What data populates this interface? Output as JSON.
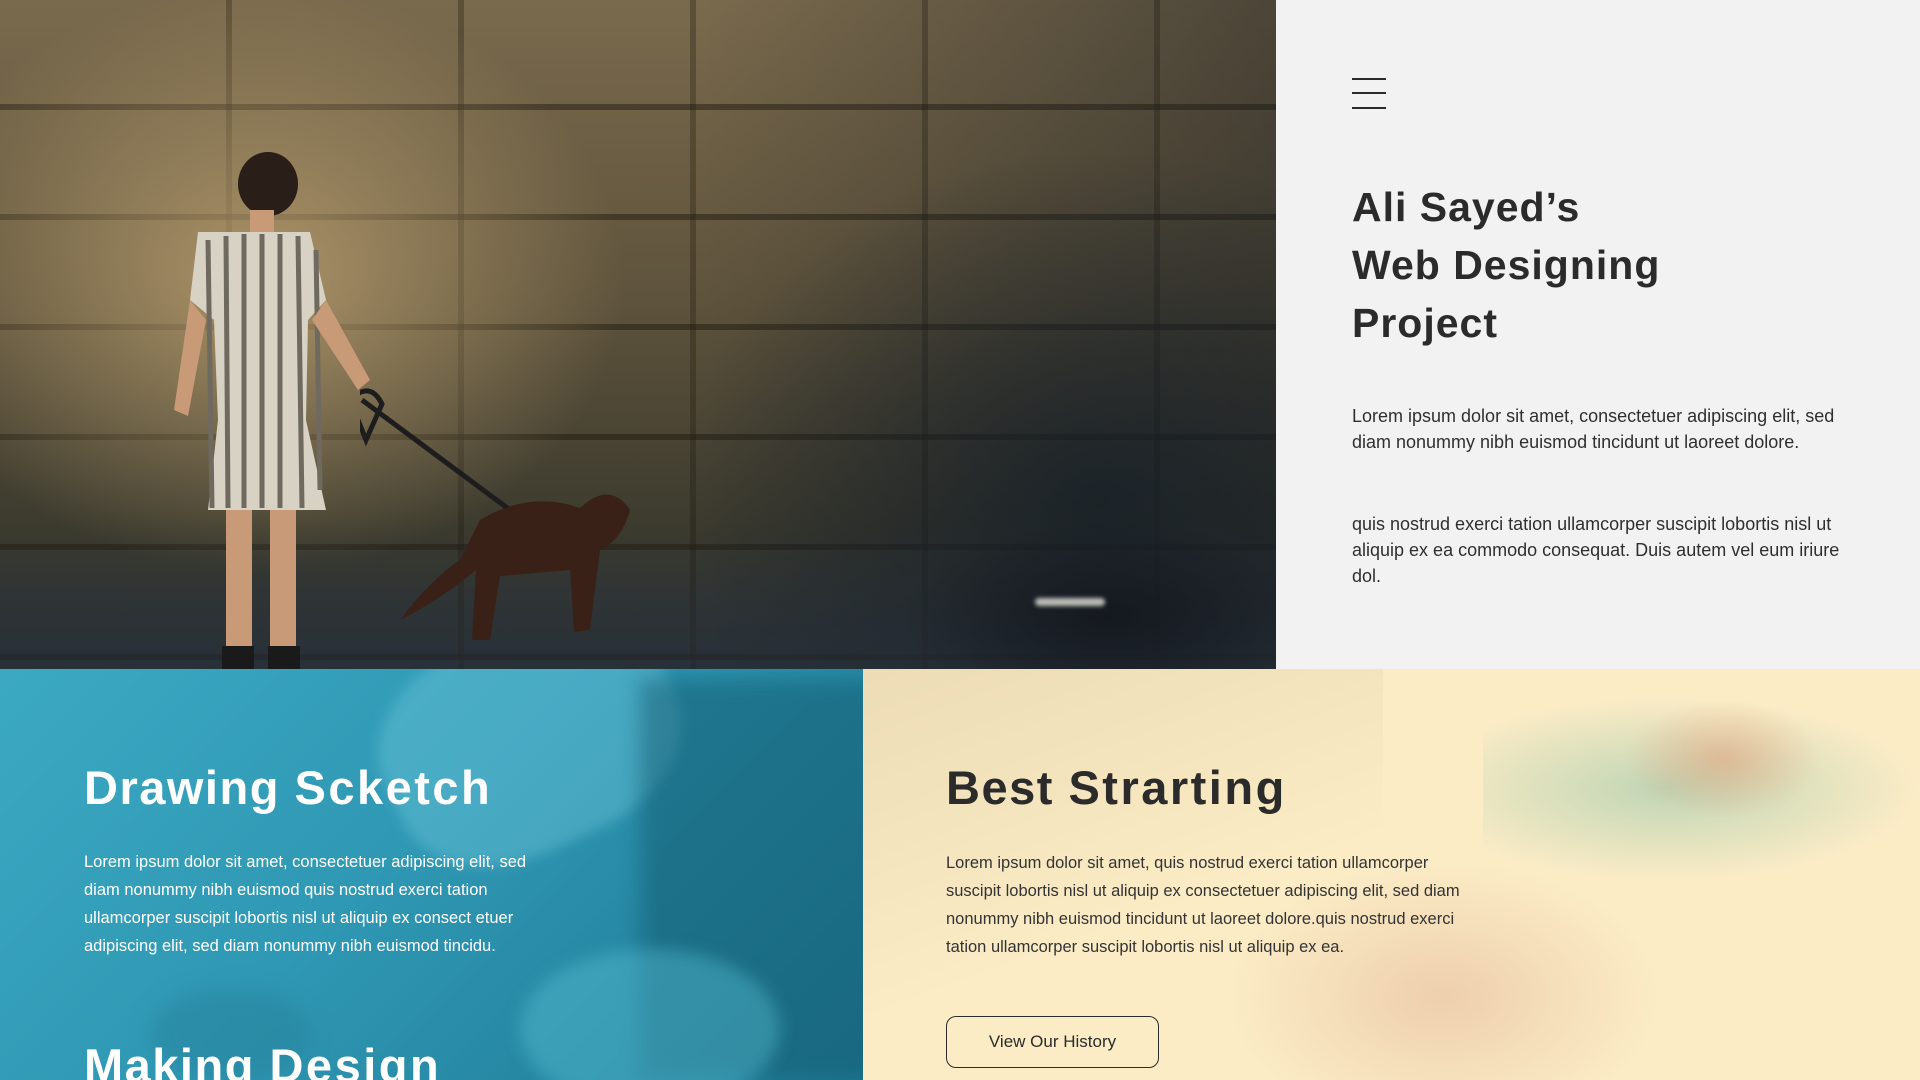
{
  "hero": {
    "image_subject": "woman-walking-dog-by-stone-wall"
  },
  "intro": {
    "menu_icon": "hamburger-menu-icon",
    "title_line1": "Ali Sayed’s",
    "title_line2": "Web Designing",
    "title_line3": "Project",
    "paragraph1": "Lorem ipsum dolor sit amet, consectetuer adipiscing elit, sed diam nonummy nibh euismod tincidunt ut laoreet dolore.",
    "paragraph2": "quis nostrud exerci tation ullamcorper suscipit lobortis nisl ut aliquip ex ea commodo consequat. Duis autem vel eum iriure dol."
  },
  "drawing": {
    "heading_light": "Drawing",
    "heading_bold": "Scketch",
    "text": "Lorem ipsum dolor sit amet, consectetuer adipiscing elit, sed diam nonummy nibh euismod quis nostrud exerci tation ullamcorper suscipit lobortis nisl ut aliquip ex consect etuer adipiscing elit, sed diam nonummy nibh euismod tincidu.",
    "next_heading_light": "Making",
    "next_heading_bold": "Design",
    "background_color": "#3ca9c2"
  },
  "starting": {
    "heading_light": "Best",
    "heading_bold": "Strarting",
    "text": "Lorem ipsum dolor sit amet, quis nostrud exerci tation ullamcorper suscipit lobortis nisl ut aliquip ex consectetuer adipiscing elit, sed diam nonummy nibh euismod tincidunt ut laoreet dolore.quis nostrud exerci tation ullamcorper suscipit lobortis nisl ut aliquip ex ea.",
    "button_label": "View Our History",
    "background_color": "#fbecc6"
  }
}
